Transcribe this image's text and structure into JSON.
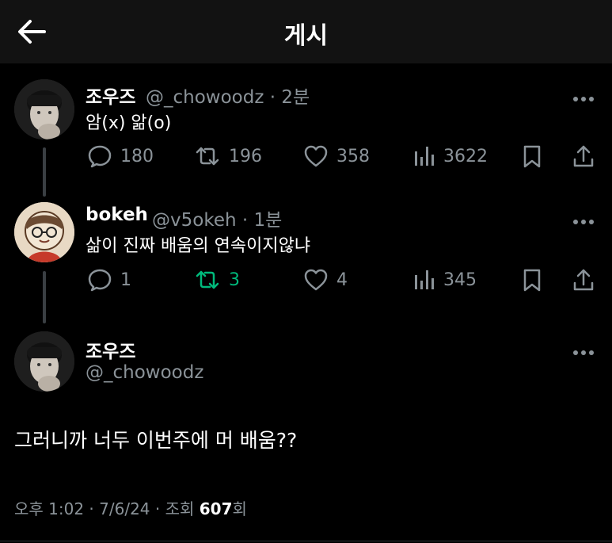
{
  "header": {
    "title": "게시",
    "back_icon": "back-arrow-icon"
  },
  "posts": [
    {
      "display_name": "조우즈",
      "meta": "@_chowoodz · 2분",
      "text": "암(x) 앎(o)",
      "stats": {
        "replies": "180",
        "reposts": "196",
        "likes": "358",
        "views": "3622"
      }
    },
    {
      "display_name": "bokeh",
      "meta": "@v5okeh · 1분",
      "text": "삶이 진짜 배움의 연속이지않냐",
      "stats": {
        "replies": "1",
        "reposts": "3",
        "likes": "4",
        "views": "345"
      },
      "reposted": true
    }
  ],
  "main_post": {
    "display_name": "조우즈",
    "handle": "@_chowoodz",
    "text": "그러니까 너두 이번주에 머 배움??",
    "meta_prefix": "오후 1:02 · 7/6/24 · 조회 ",
    "views": "607",
    "views_suffix": "회"
  },
  "colors": {
    "background": "#000000",
    "header_bg": "#121212",
    "text": "#e7e9ea",
    "muted": "#8b9399",
    "repost_active": "#00ba7c"
  }
}
